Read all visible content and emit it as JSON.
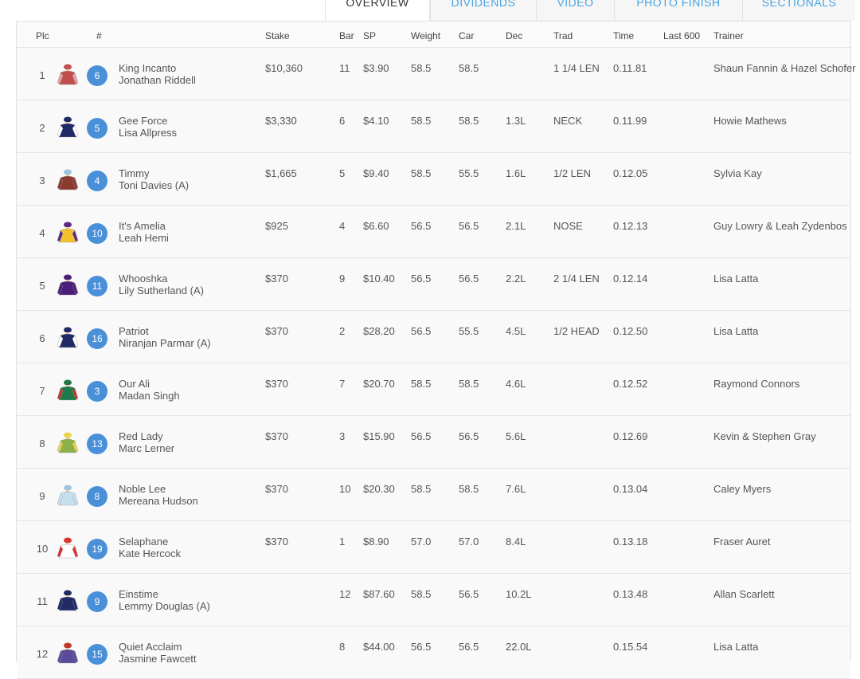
{
  "tabs": [
    {
      "label": "OVERVIEW",
      "active": true
    },
    {
      "label": "DIVIDENDS",
      "active": false
    },
    {
      "label": "VIDEO",
      "active": false
    },
    {
      "label": "PHOTO FINISH",
      "active": false
    },
    {
      "label": "SECTIONALS",
      "active": false
    }
  ],
  "headers": {
    "plc": "Plc",
    "num": "#",
    "stake": "Stake",
    "bar": "Bar",
    "sp": "SP",
    "weight": "Weight",
    "car": "Car",
    "dec": "Dec",
    "trad": "Trad",
    "time": "Time",
    "last600": "Last 600",
    "trainer": "Trainer"
  },
  "rows": [
    {
      "plc": "1",
      "num": "6",
      "horse": "King Incanto",
      "jockey": "Jonathan Riddell",
      "stake": "$10,360",
      "bar": "11",
      "sp": "$3.90",
      "weight": "58.5",
      "car": "58.5",
      "dec": "",
      "trad": "1 1/4 LEN",
      "time": "0.11.81",
      "trainer": "Shaun Fannin & Hazel Schofer",
      "silk": {
        "body": "#c0504d",
        "sleeve": "#e8a0a0",
        "cap": "#c0504d"
      }
    },
    {
      "plc": "2",
      "num": "5",
      "horse": "Gee Force",
      "jockey": "Lisa Allpress",
      "stake": "$3,330",
      "bar": "6",
      "sp": "$4.10",
      "weight": "58.5",
      "car": "58.5",
      "dec": "1.3L",
      "trad": "NECK",
      "time": "0.11.99",
      "trainer": "Howie Mathews",
      "silk": {
        "body": "#1f2a66",
        "sleeve": "#ffffff",
        "cap": "#1f2a66"
      }
    },
    {
      "plc": "3",
      "num": "4",
      "horse": "Timmy",
      "jockey": "Toni Davies (A)",
      "stake": "$1,665",
      "bar": "5",
      "sp": "$9.40",
      "weight": "58.5",
      "car": "55.5",
      "dec": "1.6L",
      "trad": "1/2 LEN",
      "time": "0.12.05",
      "trainer": "Sylvia Kay",
      "silk": {
        "body": "#8b3a2e",
        "sleeve": "#8b3a2e",
        "cap": "#9fc4e0"
      }
    },
    {
      "plc": "4",
      "num": "10",
      "horse": "It's Amelia",
      "jockey": "Leah Hemi",
      "stake": "$925",
      "bar": "4",
      "sp": "$6.60",
      "weight": "56.5",
      "car": "56.5",
      "dec": "2.1L",
      "trad": "NOSE",
      "time": "0.12.13",
      "trainer": "Guy Lowry & Leah Zydenbos",
      "silk": {
        "body": "#f2c12e",
        "sleeve": "#5b2a86",
        "cap": "#5b2a86"
      }
    },
    {
      "plc": "5",
      "num": "11",
      "horse": "Whooshka",
      "jockey": "Lily Sutherland (A)",
      "stake": "$370",
      "bar": "9",
      "sp": "$10.40",
      "weight": "56.5",
      "car": "56.5",
      "dec": "2.2L",
      "trad": "2 1/4 LEN",
      "time": "0.12.14",
      "trainer": "Lisa Latta",
      "silk": {
        "body": "#4b1e7a",
        "sleeve": "#4b1e7a",
        "cap": "#4b1e7a"
      }
    },
    {
      "plc": "6",
      "num": "16",
      "horse": "Patriot",
      "jockey": "Niranjan Parmar (A)",
      "stake": "$370",
      "bar": "2",
      "sp": "$28.20",
      "weight": "56.5",
      "car": "55.5",
      "dec": "4.5L",
      "trad": "1/2 HEAD",
      "time": "0.12.50",
      "trainer": "Lisa Latta",
      "silk": {
        "body": "#1f2a66",
        "sleeve": "#ffffff",
        "cap": "#1f2a66"
      }
    },
    {
      "plc": "7",
      "num": "3",
      "horse": "Our Ali",
      "jockey": "Madan Singh",
      "stake": "$370",
      "bar": "7",
      "sp": "$20.70",
      "weight": "58.5",
      "car": "58.5",
      "dec": "4.6L",
      "trad": "",
      "time": "0.12.52",
      "trainer": "Raymond Connors",
      "silk": {
        "body": "#1e7a4a",
        "sleeve": "#c0392b",
        "cap": "#1e7a4a"
      }
    },
    {
      "plc": "8",
      "num": "13",
      "horse": "Red Lady",
      "jockey": "Marc Lerner",
      "stake": "$370",
      "bar": "3",
      "sp": "$15.90",
      "weight": "56.5",
      "car": "56.5",
      "dec": "5.6L",
      "trad": "",
      "time": "0.12.69",
      "trainer": "Kevin & Stephen Gray",
      "silk": {
        "body": "#8cb04a",
        "sleeve": "#e8d34a",
        "cap": "#e8d34a"
      }
    },
    {
      "plc": "9",
      "num": "8",
      "horse": "Noble Lee",
      "jockey": "Mereana Hudson",
      "stake": "$370",
      "bar": "10",
      "sp": "$20.30",
      "weight": "58.5",
      "car": "58.5",
      "dec": "7.6L",
      "trad": "",
      "time": "0.13.04",
      "trainer": "Caley Myers",
      "silk": {
        "body": "#c8dff0",
        "sleeve": "#c8dff0",
        "cap": "#9fc4e0"
      }
    },
    {
      "plc": "10",
      "num": "19",
      "horse": "Selaphane",
      "jockey": "Kate Hercock",
      "stake": "$370",
      "bar": "1",
      "sp": "$8.90",
      "weight": "57.0",
      "car": "57.0",
      "dec": "8.4L",
      "trad": "",
      "time": "0.13.18",
      "trainer": "Fraser Auret",
      "silk": {
        "body": "#ffffff",
        "sleeve": "#d33",
        "cap": "#d33"
      }
    },
    {
      "plc": "11",
      "num": "9",
      "horse": "Einstime",
      "jockey": "Lemmy Douglas (A)",
      "stake": "",
      "bar": "12",
      "sp": "$87.60",
      "weight": "58.5",
      "car": "56.5",
      "dec": "10.2L",
      "trad": "",
      "time": "0.13.48",
      "trainer": "Allan Scarlett",
      "silk": {
        "body": "#1f2a66",
        "sleeve": "#1f2a66",
        "cap": "#1f2a66"
      }
    },
    {
      "plc": "12",
      "num": "15",
      "horse": "Quiet Acclaim",
      "jockey": "Jasmine Fawcett",
      "stake": "",
      "bar": "8",
      "sp": "$44.00",
      "weight": "56.5",
      "car": "56.5",
      "dec": "22.0L",
      "trad": "",
      "time": "0.15.54",
      "trainer": "Lisa Latta",
      "silk": {
        "body": "#5a4a9a",
        "sleeve": "#5a4a9a",
        "cap": "#c0392b"
      }
    }
  ]
}
